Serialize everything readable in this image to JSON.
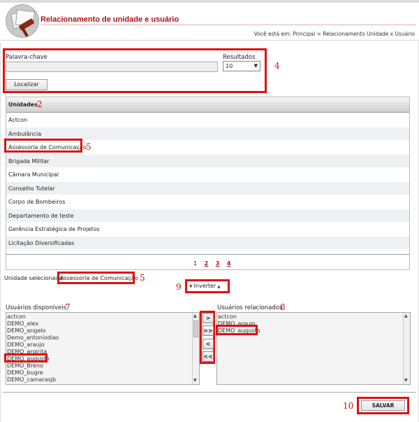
{
  "header": {
    "title": "Relacionamento de unidade e usuário",
    "breadcrumb": "Você está em: Principal > Relacionamento Unidade x Usuário"
  },
  "search": {
    "keyword_label": "Palavra-chave",
    "keyword_value": "",
    "results_label": "Resultados",
    "results_value": "10",
    "find_button": "Localizar"
  },
  "units_table": {
    "header": "Unidades",
    "rows": [
      "Actcon",
      "Ambulância",
      "Assessoria de Comunicação",
      "Brigada Militar",
      "Câmara Municipal",
      "Conselho Tutelar",
      "Corpo de Bombeiros",
      "Departamento de teste",
      "Gerência Estratégica de Projetos",
      "Licitação Diversificadas"
    ],
    "pages": [
      "1",
      "2",
      "3",
      "4"
    ],
    "current_page": "1"
  },
  "selected_unit": {
    "label": "Unidade selecionada:",
    "value": "Assessoria de Comunicação"
  },
  "invert_button": "Inverter",
  "available_users": {
    "label": "Usuários disponíveis",
    "items": [
      "actcon",
      "DEMO_alex",
      "DEMO_angelo",
      "Demo_antoniodias",
      "DEMO_araujo",
      "DEMO_argirita",
      "DEMO_augusto",
      "DEMO_Breno",
      "DEMO_bugre",
      "DEMO_camarasjb",
      "DEMO_claudio"
    ]
  },
  "related_users": {
    "label": "Usuários relacionados",
    "items": [
      "actcon",
      "DEMO_araujo",
      "DEMO_augusto"
    ]
  },
  "move_buttons": {
    "add": ">",
    "add_all": ">>",
    "remove": "<",
    "remove_all": "<<"
  },
  "save_button": "SALVAR",
  "annotations": [
    "4",
    "2",
    "5",
    "5",
    "9",
    "7",
    "8",
    "10"
  ],
  "colors": {
    "accent": "#b01010",
    "annotation": "#e01010",
    "row_alt": "#eef0f4"
  }
}
